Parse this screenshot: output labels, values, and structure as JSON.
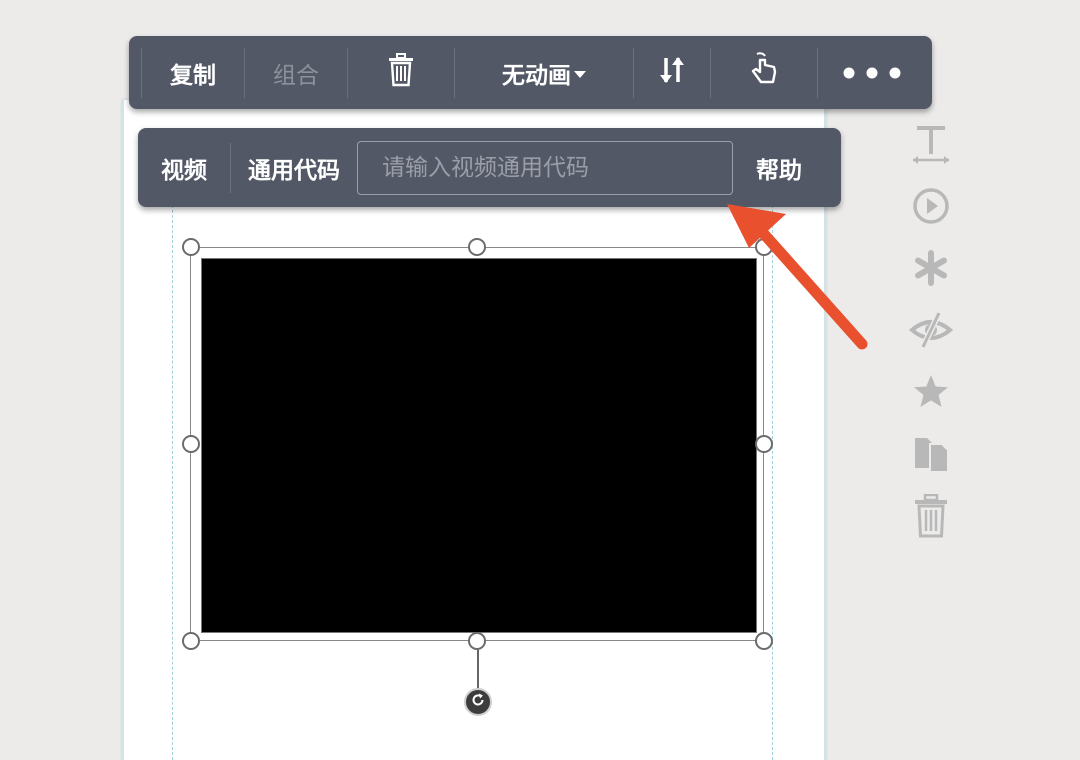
{
  "main_toolbar": {
    "copy_label": "复制",
    "group_label": "组合",
    "delete_icon": "trash-icon",
    "animation_label": "无动画",
    "order_icon": "sort-arrows-icon",
    "interaction_icon": "tap-hand-icon",
    "more_icon": "more-dots-icon"
  },
  "video_toolbar": {
    "type_label": "视频",
    "code_label": "通用代码",
    "code_input": {
      "value": "",
      "placeholder": "请输入视频通用代码"
    },
    "help_label": "帮助"
  },
  "side_tools": [
    {
      "icon": "text-icon"
    },
    {
      "icon": "play-circle-icon"
    },
    {
      "icon": "asterisk-icon"
    },
    {
      "icon": "eye-slash-icon"
    },
    {
      "icon": "star-icon"
    },
    {
      "icon": "copy-pages-icon"
    },
    {
      "icon": "trash-icon"
    }
  ],
  "colors": {
    "toolbar_bg": "#535866",
    "annotation_arrow": "#e8502e",
    "side_icon": "#b8b8b8",
    "canvas_bg": "#ecebea"
  }
}
